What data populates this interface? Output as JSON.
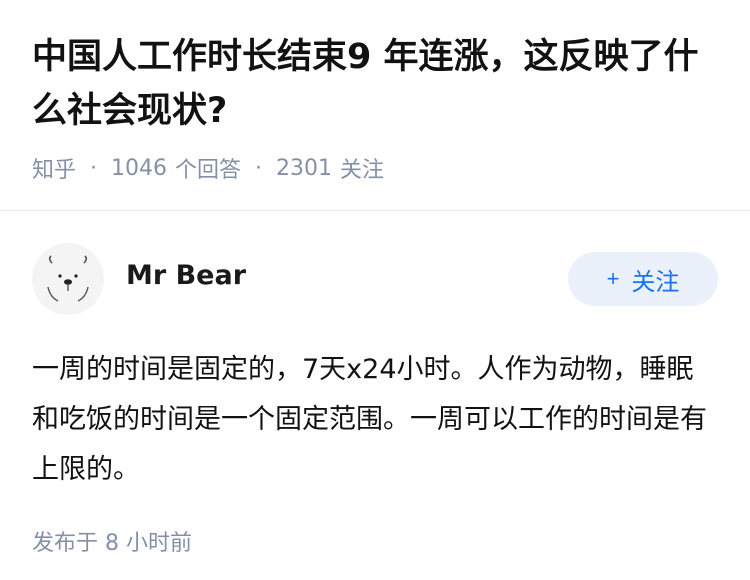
{
  "question": {
    "title": "中国人工作时长结束9 年连涨，这反映了什么社会现状?",
    "source": "知乎",
    "answer_count": "1046",
    "answer_label": "个回答",
    "follower_count": "2301",
    "follower_label": "关注",
    "separator": "·"
  },
  "answer": {
    "author_name": "Mr Bear",
    "follow_plus": "+",
    "follow_label": "关注",
    "body": "一周的时间是固定的，7天x24小时。人作为动物，睡眠和吃饭的时间是一个固定范围。一周可以工作的时间是有上限的。",
    "published": "发布于  8 小时前"
  },
  "icons": {
    "avatar": "polar-bear-avatar"
  },
  "colors": {
    "accent": "#1772f6",
    "meta": "#8590a6"
  }
}
